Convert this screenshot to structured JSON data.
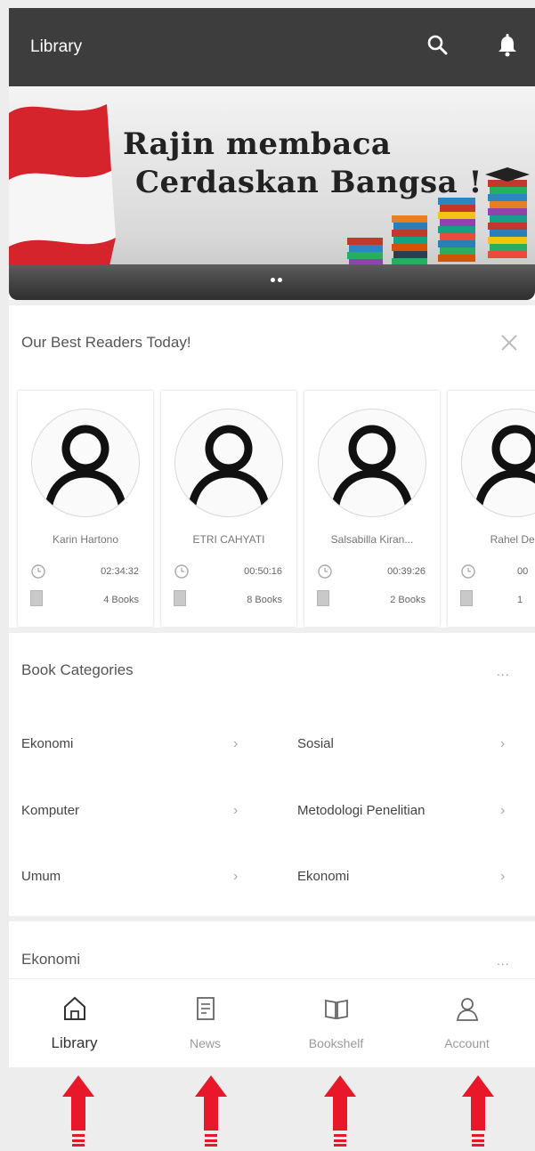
{
  "appbar": {
    "title": "Library",
    "icons": [
      "search-icon",
      "bell-icon"
    ]
  },
  "banner": {
    "line1": "Rajin membaca",
    "line2": "Cerdaskan Bangsa !"
  },
  "readers_section": {
    "title": "Our Best Readers Today!",
    "close_icon": "close-icon",
    "readers": [
      {
        "name": "Karin Hartono",
        "time": "02:34:32",
        "books": "4 Books"
      },
      {
        "name": "ETRI CAHYATI",
        "time": "00:50:16",
        "books": "8 Books"
      },
      {
        "name": "Salsabilla Kiran...",
        "time": "00:39:26",
        "books": "2 Books"
      },
      {
        "name": "Rahel Deb",
        "time": "00",
        "books": "1"
      }
    ]
  },
  "categories_section": {
    "title": "Book Categories",
    "more": "...",
    "items": [
      {
        "label": "Ekonomi"
      },
      {
        "label": "Sosial"
      },
      {
        "label": "Komputer"
      },
      {
        "label": "Metodologi Penelitian"
      },
      {
        "label": "Umum"
      },
      {
        "label": "Ekonomi"
      }
    ]
  },
  "ekonomi_section": {
    "title": "Ekonomi",
    "more": "..."
  },
  "bottom_nav": {
    "items": [
      {
        "label": "Library",
        "icon": "home-icon",
        "active": true
      },
      {
        "label": "News",
        "icon": "news-icon",
        "active": false
      },
      {
        "label": "Bookshelf",
        "icon": "book-open-icon",
        "active": false
      },
      {
        "label": "Account",
        "icon": "person-icon",
        "active": false
      }
    ]
  },
  "colors": {
    "appbar": "#3d3d3d",
    "arrow": "#e8182a",
    "flag_red": "#d6242c"
  }
}
